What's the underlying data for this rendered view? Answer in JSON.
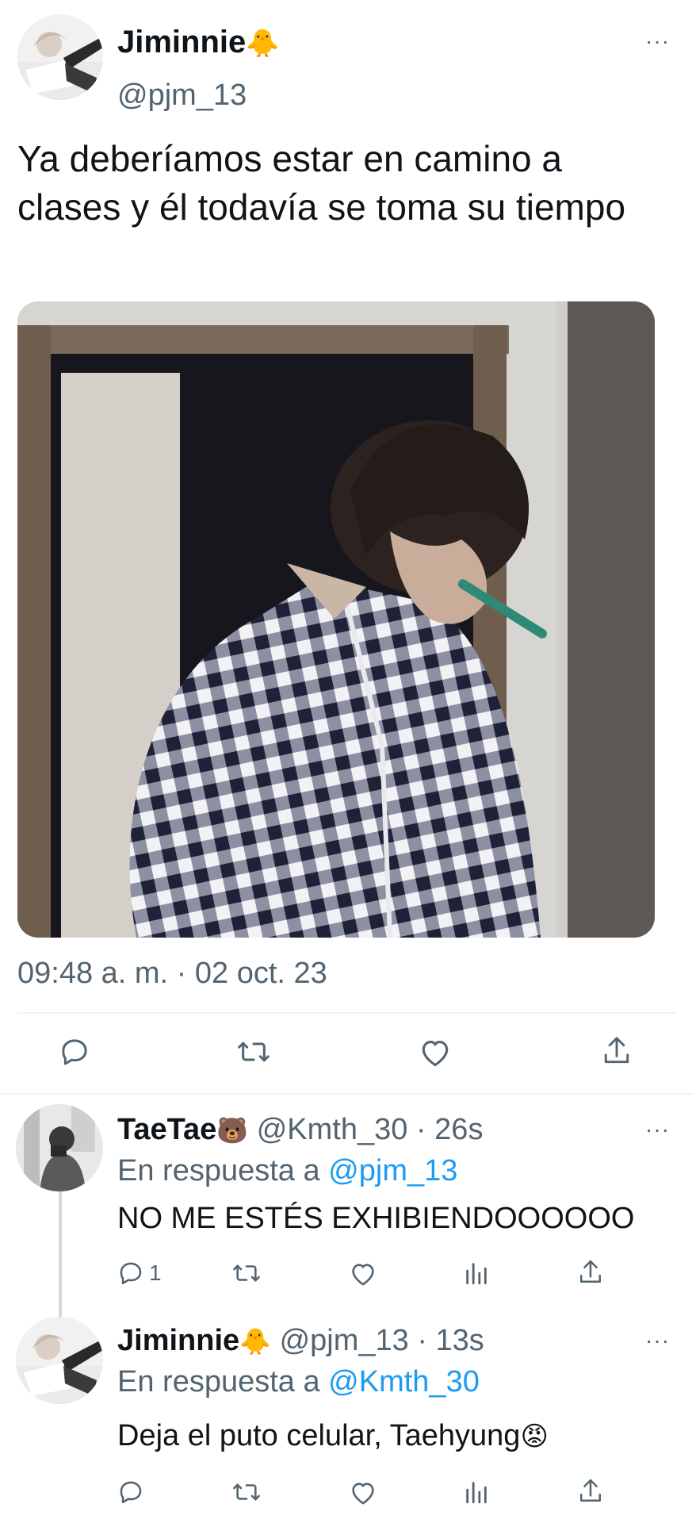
{
  "main_tweet": {
    "author_name": "Jiminnie",
    "author_emoji": "🐥",
    "handle": "@pjm_13",
    "text": "Ya deberíamos estar en camino a clases y él todavía se toma su tiempo",
    "timestamp": "09:48 a. m. · 02 oct. 23",
    "more_label": "···"
  },
  "replies": [
    {
      "author_name": "TaeTae",
      "author_emoji": "🐻",
      "meta": "@Kmth_30 · 26s",
      "reply_prefix": "En respuesta a ",
      "reply_to": "@pjm_13",
      "text": "NO ME ESTÉS EXHIBIENDOOOOOO",
      "reply_count": "1",
      "more_label": "···"
    },
    {
      "author_name": "Jiminnie",
      "author_emoji": "🐥",
      "meta": "@pjm_13 · 13s",
      "reply_prefix": "En respuesta a ",
      "reply_to": "@Kmth_30",
      "text": "Deja el puto celular, Taehyung",
      "text_emoji": "😡",
      "reply_count": "",
      "more_label": "···"
    }
  ],
  "icons": {
    "reply": "comment-icon",
    "retweet": "retweet-icon",
    "like": "heart-icon",
    "views": "views-icon",
    "share": "share-icon"
  }
}
